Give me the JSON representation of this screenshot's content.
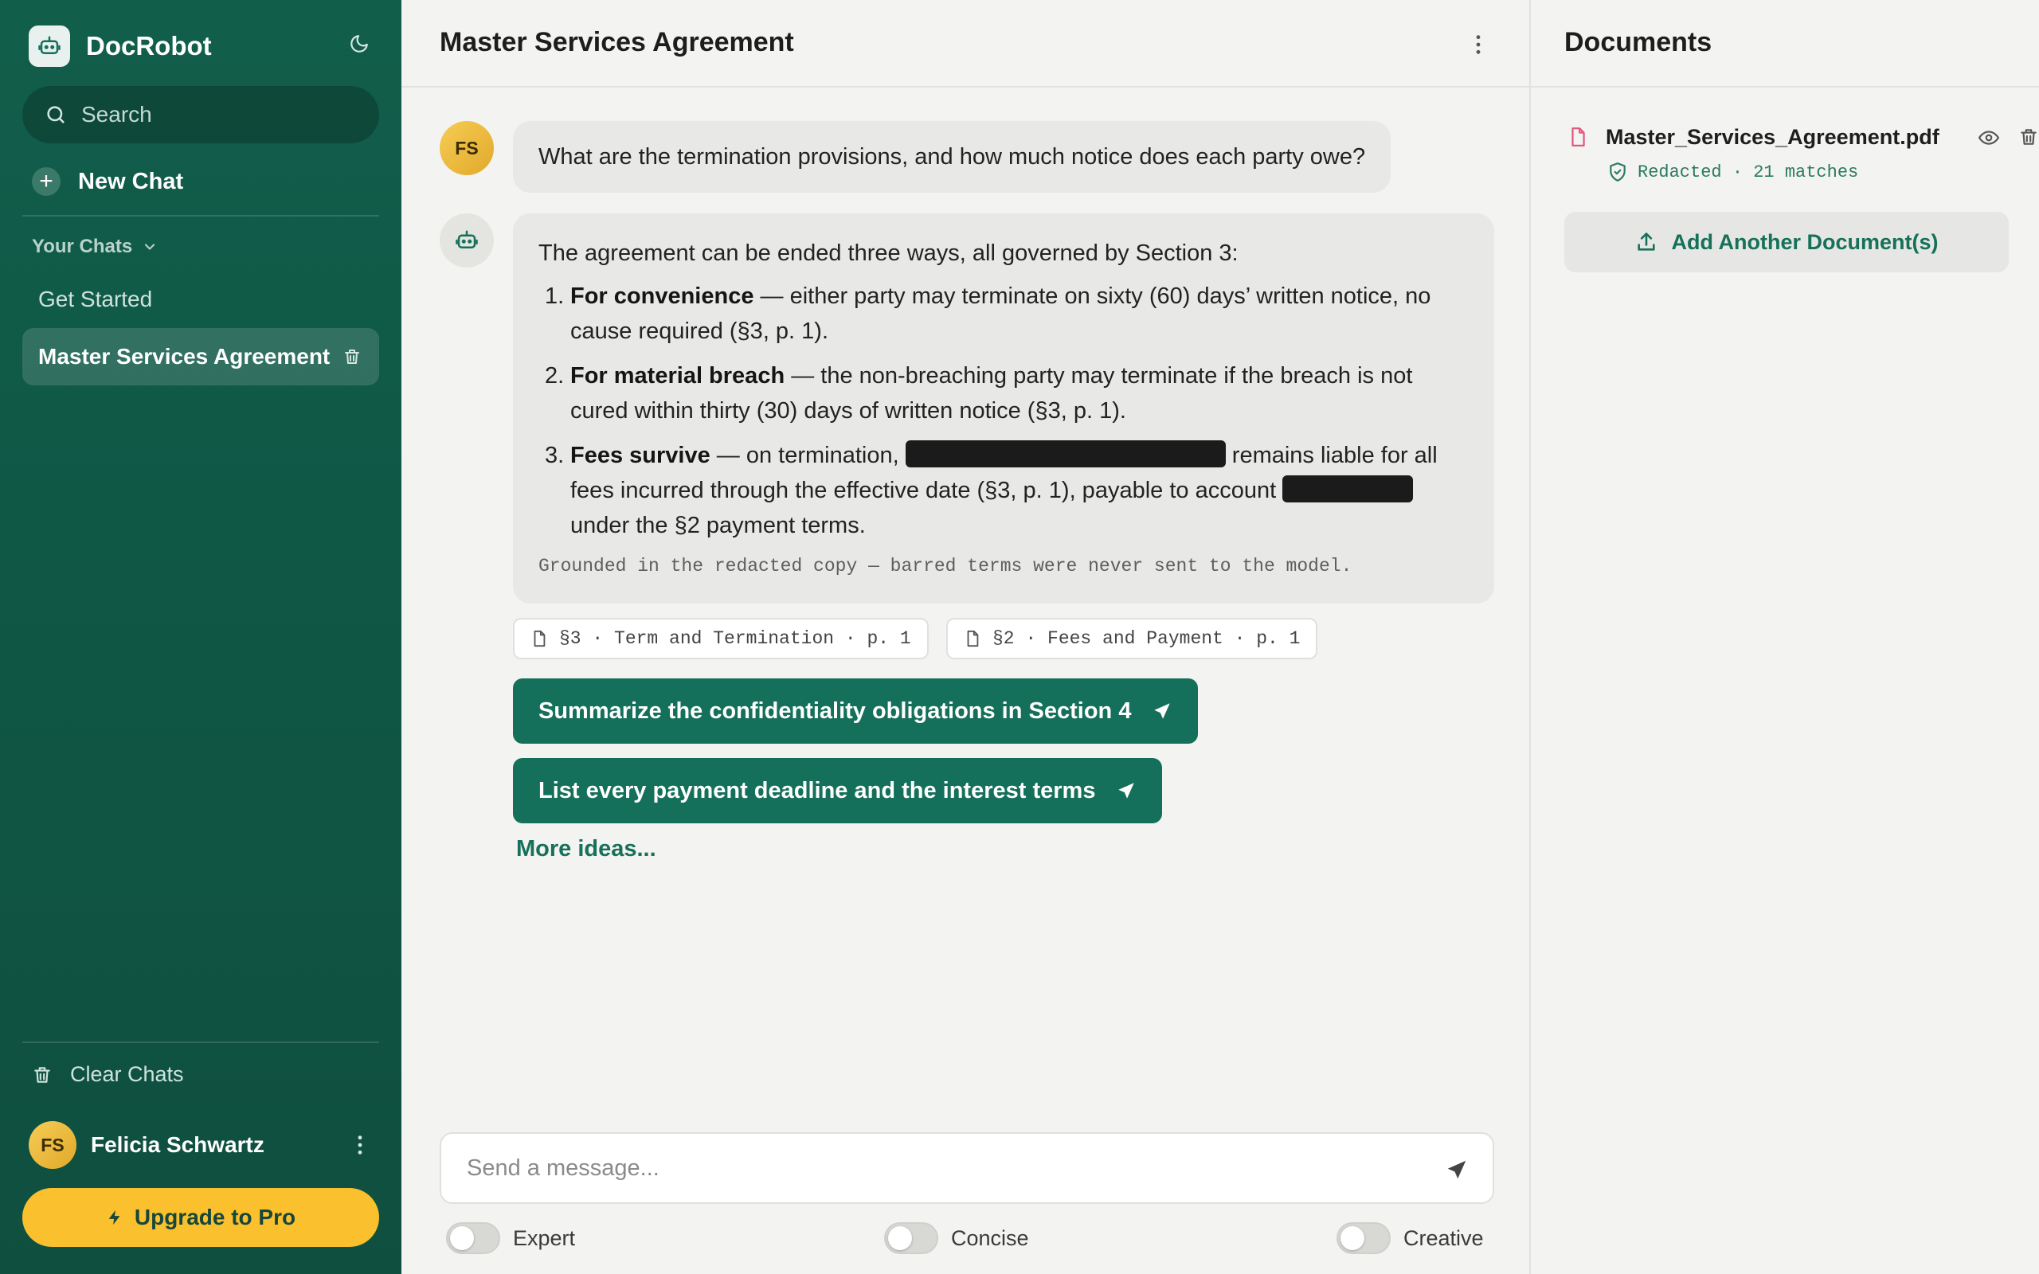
{
  "app": {
    "name": "DocRobot"
  },
  "sidebar": {
    "search_placeholder": "Search",
    "new_chat_label": "New Chat",
    "your_chats_label": "Your Chats",
    "chats": [
      {
        "label": "Get Started",
        "active": false
      },
      {
        "label": "Master Services Agreement",
        "active": true
      }
    ],
    "clear_chats_label": "Clear Chats",
    "user": {
      "initials": "FS",
      "name": "Felicia Schwartz"
    },
    "upgrade_label": "Upgrade to Pro"
  },
  "main": {
    "title": "Master Services Agreement",
    "user_message": {
      "avatar": "FS",
      "text": "What are the termination provisions, and how much notice does each party owe?"
    },
    "bot_message": {
      "intro": "The agreement can be ended three ways, all governed by Section 3:",
      "items": [
        {
          "num": "1.",
          "term": "For convenience",
          "text": " — either party may terminate on sixty (60) days’ written notice, no cause required (§3, p. 1)."
        },
        {
          "num": "2.",
          "term": "For material breach",
          "text": " — the non-breaching party may terminate if the breach is not cured within thirty (30) days of written notice (§3, p. 1)."
        },
        {
          "num": "3.",
          "term": "Fees survive",
          "text_a": " — on termination, ",
          "text_b": " remains liable for all fees incurred through the effective date (§3, p. 1), payable to account ",
          "text_c": " under the §2 payment terms."
        }
      ],
      "grounded_note": "Grounded in the redacted copy — barred terms were never sent to the model."
    },
    "citations": [
      "§3 · Term and Termination · p. 1",
      "§2 · Fees and Payment · p. 1"
    ],
    "suggestions": [
      "Summarize the confidentiality obligations in Section 4",
      "List every payment deadline and the interest terms"
    ],
    "more_ideas_label": "More ideas...",
    "composer_placeholder": "Send a message...",
    "toggles": [
      {
        "label": "Expert",
        "on": false
      },
      {
        "label": "Concise",
        "on": false
      },
      {
        "label": "Creative",
        "on": false
      }
    ]
  },
  "documents": {
    "title": "Documents",
    "files": [
      {
        "name": "Master_Services_Agreement.pdf",
        "status": "Redacted · 21 matches"
      }
    ],
    "add_label": "Add Another Document(s)"
  },
  "colors": {
    "sidebar": "#115e4b",
    "accent": "#14705a",
    "upgrade": "#fbc02d",
    "pdf_icon": "#e0567a"
  }
}
